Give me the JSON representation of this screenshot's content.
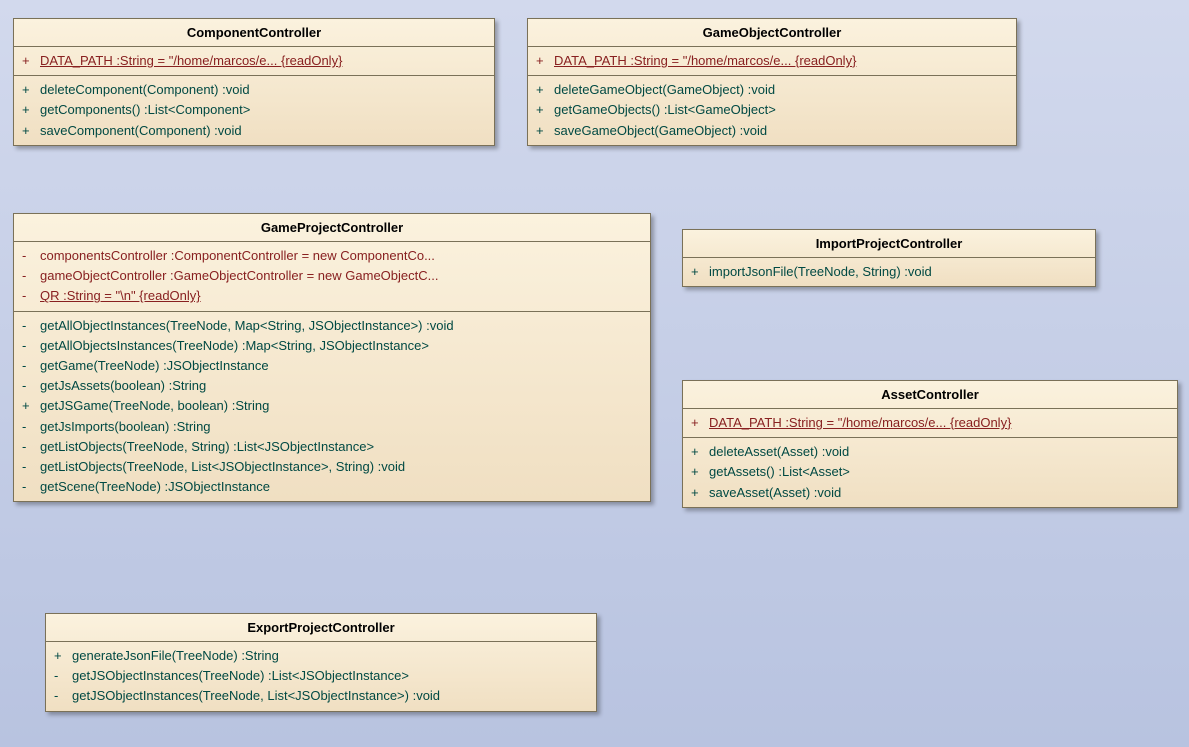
{
  "classes": {
    "componentController": {
      "name": "ComponentController",
      "attributes": [
        {
          "visibility": "+",
          "text": "DATA_PATH  :String = \"/home/marcos/e... {readOnly}",
          "static": true
        }
      ],
      "operations": [
        {
          "visibility": "+",
          "text": "deleteComponent(Component)  :void"
        },
        {
          "visibility": "+",
          "text": "getComponents()  :List<Component>"
        },
        {
          "visibility": "+",
          "text": "saveComponent(Component)  :void"
        }
      ]
    },
    "gameObjectController": {
      "name": "GameObjectController",
      "attributes": [
        {
          "visibility": "+",
          "text": "DATA_PATH  :String = \"/home/marcos/e... {readOnly}",
          "static": true
        }
      ],
      "operations": [
        {
          "visibility": "+",
          "text": "deleteGameObject(GameObject)  :void"
        },
        {
          "visibility": "+",
          "text": "getGameObjects()  :List<GameObject>"
        },
        {
          "visibility": "+",
          "text": "saveGameObject(GameObject)  :void"
        }
      ]
    },
    "gameProjectController": {
      "name": "GameProjectController",
      "attributes": [
        {
          "visibility": "-",
          "text": "componentsController  :ComponentController = new ComponentCo...",
          "static": false
        },
        {
          "visibility": "-",
          "text": "gameObjectController  :GameObjectController = new GameObjectC...",
          "static": false
        },
        {
          "visibility": "-",
          "text": "QR  :String = \"\\n\" {readOnly}",
          "static": true
        }
      ],
      "operations": [
        {
          "visibility": "-",
          "text": "getAllObjectInstances(TreeNode, Map<String, JSObjectInstance>)  :void"
        },
        {
          "visibility": "-",
          "text": "getAllObjectsInstances(TreeNode)  :Map<String, JSObjectInstance>"
        },
        {
          "visibility": "-",
          "text": "getGame(TreeNode)  :JSObjectInstance"
        },
        {
          "visibility": "-",
          "text": "getJsAssets(boolean)  :String"
        },
        {
          "visibility": "+",
          "text": "getJSGame(TreeNode, boolean)  :String"
        },
        {
          "visibility": "-",
          "text": "getJsImports(boolean)  :String"
        },
        {
          "visibility": "-",
          "text": "getListObjects(TreeNode, String)  :List<JSObjectInstance>"
        },
        {
          "visibility": "-",
          "text": "getListObjects(TreeNode, List<JSObjectInstance>, String)  :void"
        },
        {
          "visibility": "-",
          "text": "getScene(TreeNode)  :JSObjectInstance"
        }
      ]
    },
    "importProjectController": {
      "name": "ImportProjectController",
      "attributes": [],
      "operations": [
        {
          "visibility": "+",
          "text": "importJsonFile(TreeNode, String)  :void"
        }
      ]
    },
    "assetController": {
      "name": "AssetController",
      "attributes": [
        {
          "visibility": "+",
          "text": "DATA_PATH  :String = \"/home/marcos/e... {readOnly}",
          "static": true
        }
      ],
      "operations": [
        {
          "visibility": "+",
          "text": "deleteAsset(Asset)  :void"
        },
        {
          "visibility": "+",
          "text": "getAssets()  :List<Asset>"
        },
        {
          "visibility": "+",
          "text": "saveAsset(Asset)  :void"
        }
      ]
    },
    "exportProjectController": {
      "name": "ExportProjectController",
      "attributes": [],
      "operations": [
        {
          "visibility": "+",
          "text": "generateJsonFile(TreeNode)  :String"
        },
        {
          "visibility": "-",
          "text": "getJSObjectInstances(TreeNode)  :List<JSObjectInstance>"
        },
        {
          "visibility": "-",
          "text": "getJSObjectInstances(TreeNode, List<JSObjectInstance>)  :void"
        }
      ]
    }
  }
}
